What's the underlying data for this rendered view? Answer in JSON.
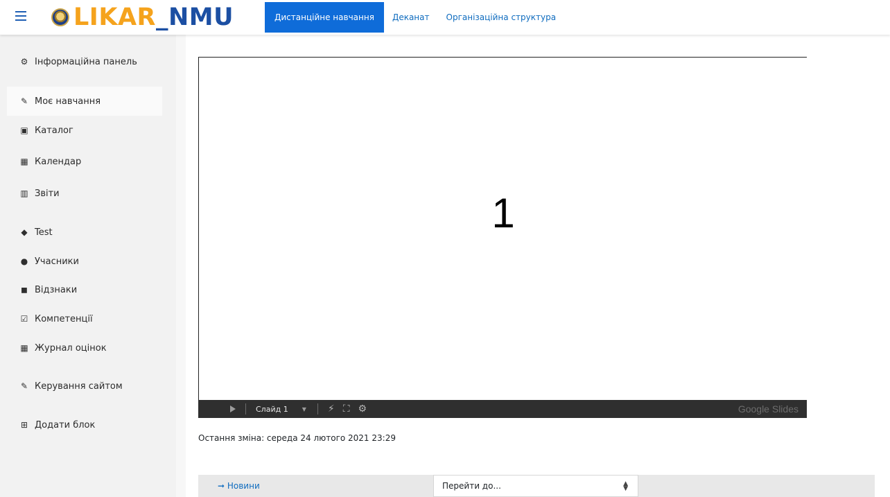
{
  "header": {
    "logo_part1": "LIKAR",
    "logo_part2": "_NMU",
    "nav": [
      {
        "label": "Дистанційне навчання",
        "active": true
      },
      {
        "label": "Деканат",
        "active": false
      },
      {
        "label": "Організаційна структура",
        "active": false
      }
    ]
  },
  "sidebar": {
    "items": [
      {
        "label": "Інформаційна панель",
        "icon": "dashboard-icon",
        "glyph": "⚙"
      },
      {
        "label": "Моє навчання",
        "icon": "my-courses-icon",
        "glyph": "✎",
        "active": true
      },
      {
        "label": "Каталог",
        "icon": "catalog-icon",
        "glyph": "▣"
      },
      {
        "label": "Календар",
        "icon": "calendar-icon",
        "glyph": "▦"
      },
      {
        "label": "Звіти",
        "icon": "reports-icon",
        "glyph": "▥"
      },
      {
        "label": "Test",
        "icon": "graduation-cap-icon",
        "glyph": "◆"
      },
      {
        "label": "Учасники",
        "icon": "users-icon",
        "glyph": "●"
      },
      {
        "label": "Відзнаки",
        "icon": "shield-icon",
        "glyph": "◼"
      },
      {
        "label": "Компетенції",
        "icon": "checkbox-icon",
        "glyph": "☑"
      },
      {
        "label": "Журнал оцінок",
        "icon": "table-icon",
        "glyph": "▦"
      },
      {
        "label": "Керування сайтом",
        "icon": "wrench-icon",
        "glyph": "✎"
      },
      {
        "label": "Додати блок",
        "icon": "plus-square-icon",
        "glyph": "⊞"
      }
    ]
  },
  "slide": {
    "number": "1",
    "toolbar": {
      "slide_label": "Слайд 1",
      "brand": "Google Slides"
    }
  },
  "last_modified": "Остання зміна: середа 24 лютого 2021 23:29",
  "bottom_nav": {
    "prev_label": "➞ Новини",
    "jump_placeholder": "Перейти до..."
  }
}
